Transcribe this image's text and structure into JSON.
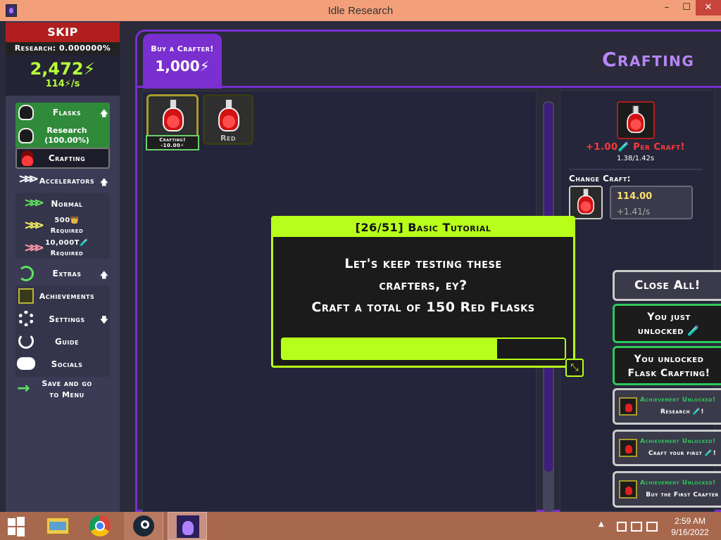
{
  "window": {
    "title": "Idle Research",
    "min_glyph": "–",
    "max_glyph": "☐",
    "close_glyph": "✕"
  },
  "sidebar": {
    "skip_tutorial": "SKIP TUTORIAL!!!",
    "research_label": "Research: 0.000000%",
    "energy": "2,472⚡",
    "energy_rate": "114⚡/s",
    "items": [
      {
        "label": "Flasks",
        "arrow": "🡅"
      },
      {
        "label": "Research (100.00%)"
      },
      {
        "label": "Crafting"
      },
      {
        "label": "Accelerators",
        "arrow": "🡅"
      },
      {
        "label": "Normal"
      },
      {
        "label": "500👑 Required"
      },
      {
        "label": "10,000T🧪 Required"
      },
      {
        "label": "Extras",
        "arrow": "🡅"
      },
      {
        "label": "Achievements"
      },
      {
        "label": "Settings",
        "arrow": "🡇"
      },
      {
        "label": "Guide"
      },
      {
        "label": "Socials"
      },
      {
        "label": "Save and go to Menu"
      }
    ]
  },
  "header": {
    "buy_crafter_label": "Buy a Crafter!",
    "buy_crafter_price": "1,000⚡",
    "page_title": "Crafting"
  },
  "crafters": [
    {
      "status": "Crafting! -10.00⚡"
    },
    {
      "label": "Red"
    }
  ],
  "info": {
    "per_craft": "+1.00🧪 Per Craft!",
    "craft_time": "1.38/1.42s",
    "change_craft": "Change Craft:",
    "count": "114.00",
    "rate": "+1.41/s"
  },
  "tutorial": {
    "heading": "[26/51] Basic Tutorial",
    "line1": "Let's keep testing these",
    "line2": "crafters, ey?",
    "line3": "Craft a total of 150 Red Flasks",
    "progress": 0.76,
    "expand_glyph": "⤡"
  },
  "notifications": {
    "close_all": "Close All!",
    "n1_line1": "You just",
    "n1_line2": "unlocked 🧪",
    "n2_line1": "You unlocked",
    "n2_line2": "Flask Crafting!",
    "achievements": [
      {
        "title": "Achievement Unlocked!",
        "desc": "Research 🧪!"
      },
      {
        "title": "Achievement Unlocked!",
        "desc": "Craft your first 🧪!"
      },
      {
        "title": "Achievement Unlocked!",
        "desc": "Buy the First Crafter"
      }
    ]
  },
  "taskbar": {
    "time": "2:59 AM",
    "date": "9/16/2022",
    "tray_up": "▲"
  },
  "colors": {
    "accent_purple": "#7a2fd0",
    "title_purple": "#b786f5",
    "tutorial_lime": "#b7ff1a",
    "energy_green": "#b6ff3a",
    "skip_red": "#b01e1e",
    "notif_green": "#2ec85a"
  }
}
